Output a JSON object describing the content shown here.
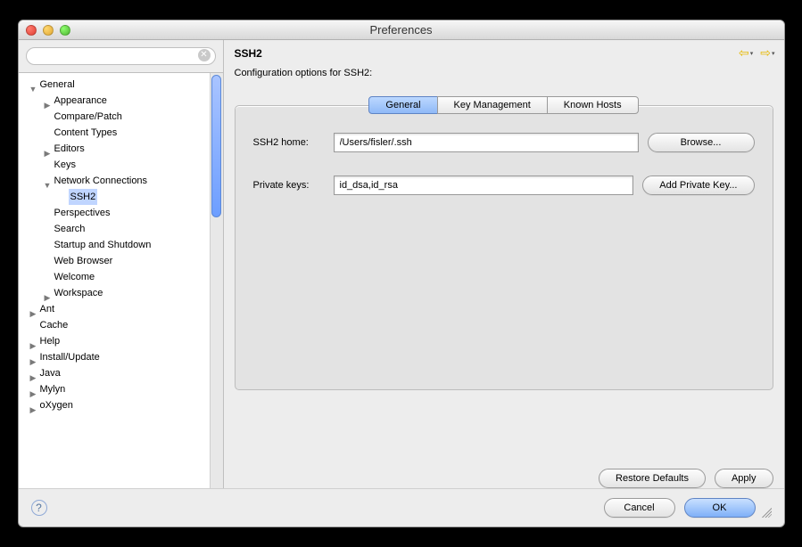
{
  "window": {
    "title": "Preferences"
  },
  "sidebar": {
    "search_value": "",
    "tree": {
      "general": "General",
      "appearance": "Appearance",
      "compare_patch": "Compare/Patch",
      "content_types": "Content Types",
      "editors": "Editors",
      "keys": "Keys",
      "network_connections": "Network Connections",
      "ssh2": "SSH2",
      "perspectives": "Perspectives",
      "search": "Search",
      "startup_shutdown": "Startup and Shutdown",
      "web_browser": "Web Browser",
      "welcome": "Welcome",
      "workspace": "Workspace",
      "ant": "Ant",
      "cache": "Cache",
      "help": "Help",
      "install_update": "Install/Update",
      "java": "Java",
      "mylyn": "Mylyn",
      "oxygen": "oXygen"
    }
  },
  "page": {
    "title": "SSH2",
    "subtitle": "Configuration options for SSH2:",
    "tabs": {
      "general": "General",
      "key_mgmt": "Key Management",
      "known_hosts": "Known Hosts"
    },
    "ssh2_home_label": "SSH2 home:",
    "ssh2_home_value": "/Users/fisler/.ssh",
    "browse": "Browse...",
    "private_keys_label": "Private keys:",
    "private_keys_value": "id_dsa,id_rsa",
    "add_private_key": "Add Private Key...",
    "restore_defaults": "Restore Defaults",
    "apply": "Apply"
  },
  "footer": {
    "cancel": "Cancel",
    "ok": "OK"
  }
}
